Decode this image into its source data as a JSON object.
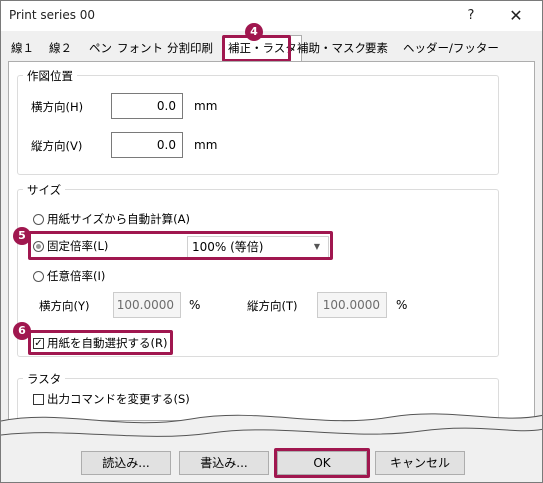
{
  "window": {
    "title": "Print series 00",
    "help_label": "?",
    "close_label": "✕"
  },
  "tabs": [
    {
      "label": "線１"
    },
    {
      "label": "線２"
    },
    {
      "label": "ペン"
    },
    {
      "label": "フォント"
    },
    {
      "label": "分割印刷"
    },
    {
      "label": "補正・ラスタ",
      "active": true
    },
    {
      "label": "補助・マスク"
    },
    {
      "label": "要素"
    },
    {
      "label": "ヘッダー/フッター"
    }
  ],
  "steps": {
    "tab_step": "4",
    "fixed_scale_step": "5",
    "auto_paper_step": "6"
  },
  "position_group": {
    "title": "作図位置",
    "horizontal_label": "横方向(H)",
    "horizontal_value": "0.0",
    "horizontal_unit": "mm",
    "vertical_label": "縦方向(V)",
    "vertical_value": "0.0",
    "vertical_unit": "mm"
  },
  "size_group": {
    "title": "サイズ",
    "auto_calc_label": "用紙サイズから自動計算(A)",
    "fixed_scale_label": "固定倍率(L)",
    "fixed_scale_value": "100% (等倍)",
    "arbitrary_scale_label": "任意倍率(I)",
    "scale_x_label": "横方向(Y)",
    "scale_x_value": "100.0000",
    "scale_x_unit": "%",
    "scale_y_label": "縦方向(T)",
    "scale_y_value": "100.0000",
    "scale_y_unit": "%",
    "auto_select_paper_label": "用紙を自動選択する(R)",
    "auto_select_paper_checked": true
  },
  "raster_group": {
    "title": "ラスタ",
    "change_output_label": "出力コマンドを変更する(S)"
  },
  "buttons": {
    "read": "読込み...",
    "write": "書込み...",
    "ok": "OK",
    "cancel": "キャンセル"
  },
  "colors": {
    "highlight": "#a0174f"
  }
}
